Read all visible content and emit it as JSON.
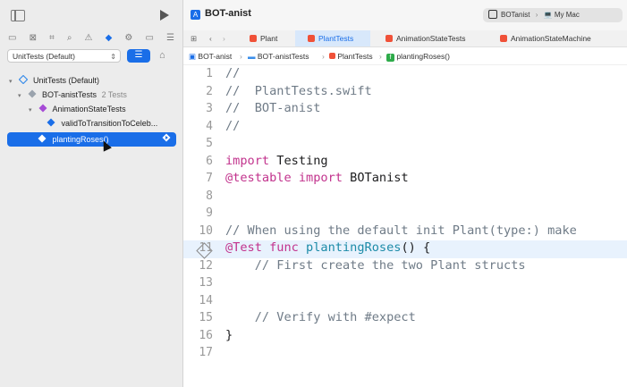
{
  "navigator": {
    "scheme": "UnitTests (Default)",
    "tree": [
      {
        "label": "UnitTests (Default)",
        "badge": "",
        "level": 0
      },
      {
        "label": "BOT-anistTests",
        "badge": "2 Tests",
        "level": 1
      },
      {
        "label": "AnimationStateTests",
        "badge": "",
        "level": 2
      },
      {
        "label": "validToTransitionToCeleb...",
        "badge": "",
        "level": 3
      },
      {
        "label": "plantingRoses()",
        "badge": "",
        "level": 2
      }
    ]
  },
  "editor": {
    "window_title": "BOT-anist",
    "scheme_target": "BOTanist",
    "destination": "My Mac",
    "tabs": [
      "Plant",
      "PlantTests",
      "AnimationStateTests",
      "AnimationStateMachine"
    ],
    "breadcrumb": [
      "BOT-anist",
      "BOT-anistTests",
      "PlantTests",
      "plantingRoses()"
    ],
    "code_lines": [
      "//",
      "//  PlantTests.swift",
      "//  BOT-anist",
      "//",
      "",
      "import Testing",
      "@testable import BOTanist",
      "",
      "",
      "// When using the default init Plant(type:) make",
      "@Test func plantingRoses() {",
      "    // First create the two Plant structs",
      "",
      "",
      "    // Verify with #expect",
      "}",
      ""
    ]
  },
  "colors": {
    "accent": "#1a6ee8",
    "keyword": "#c2338d",
    "comment": "#6f7b87",
    "function": "#1c8ba8",
    "swift_icon": "#f05138"
  }
}
